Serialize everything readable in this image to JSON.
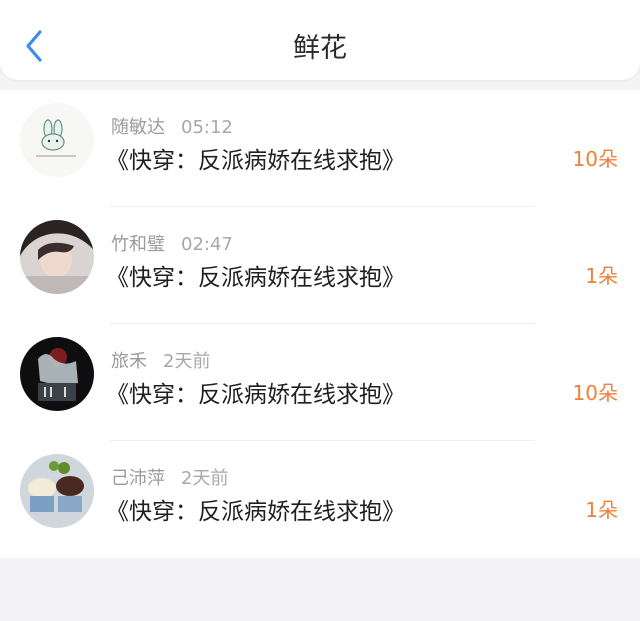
{
  "header": {
    "title": "鲜花",
    "back_icon": "chevron-left-icon",
    "accent_color": "#3a8ee6"
  },
  "items": [
    {
      "name": "随敏达",
      "time": "05:12",
      "book": "《快穿：反派病娇在线求抱》",
      "count": "10朵",
      "avatar": "bunny-sticker-avatar"
    },
    {
      "name": "竹和璧",
      "time": "02:47",
      "book": "《快穿：反派病娇在线求抱》",
      "count": "1朵",
      "avatar": "girl-photo-avatar"
    },
    {
      "name": "旅禾",
      "time": "2天前",
      "book": "《快穿：反派病娇在线求抱》",
      "count": "10朵",
      "avatar": "crystal-figure-avatar"
    },
    {
      "name": "己沛萍",
      "time": "2天前",
      "book": "《快穿：反派病娇在线求抱》",
      "count": "1朵",
      "avatar": "dessert-photo-avatar"
    }
  ],
  "colors": {
    "count": "#f07f3c",
    "meta": "#9b9b9b",
    "background": "#f4f4f6"
  }
}
